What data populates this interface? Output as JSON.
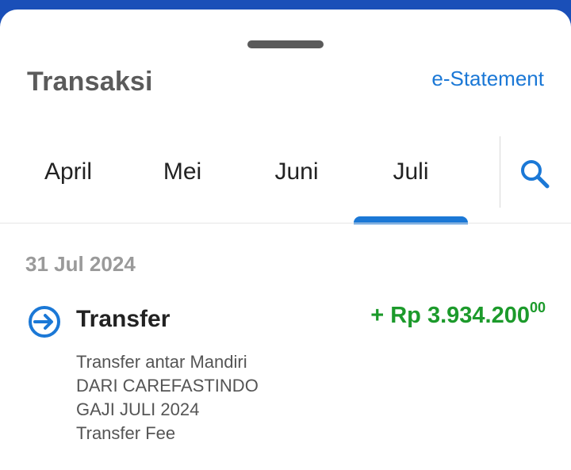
{
  "header": {
    "title": "Transaksi",
    "estatement_label": "e-Statement"
  },
  "tabs": [
    {
      "label": "April"
    },
    {
      "label": "Mei"
    },
    {
      "label": "Juni"
    },
    {
      "label": "Juli",
      "selected": true
    }
  ],
  "search": {
    "icon": "search-icon"
  },
  "transactions": {
    "date": "31 Jul 2024",
    "items": [
      {
        "icon": "transfer-in-icon",
        "type": "Transfer",
        "amount_main": "+ Rp 3.934.200",
        "amount_cents": "00",
        "details": [
          "Transfer antar Mandiri",
          "DARI CAREFASTINDO",
          "GAJI JULI 2024",
          "Transfer Fee"
        ]
      }
    ]
  },
  "colors": {
    "accent": "#1b78d6",
    "positive": "#1c9a2b",
    "top_bar": "#1a4fb8"
  }
}
